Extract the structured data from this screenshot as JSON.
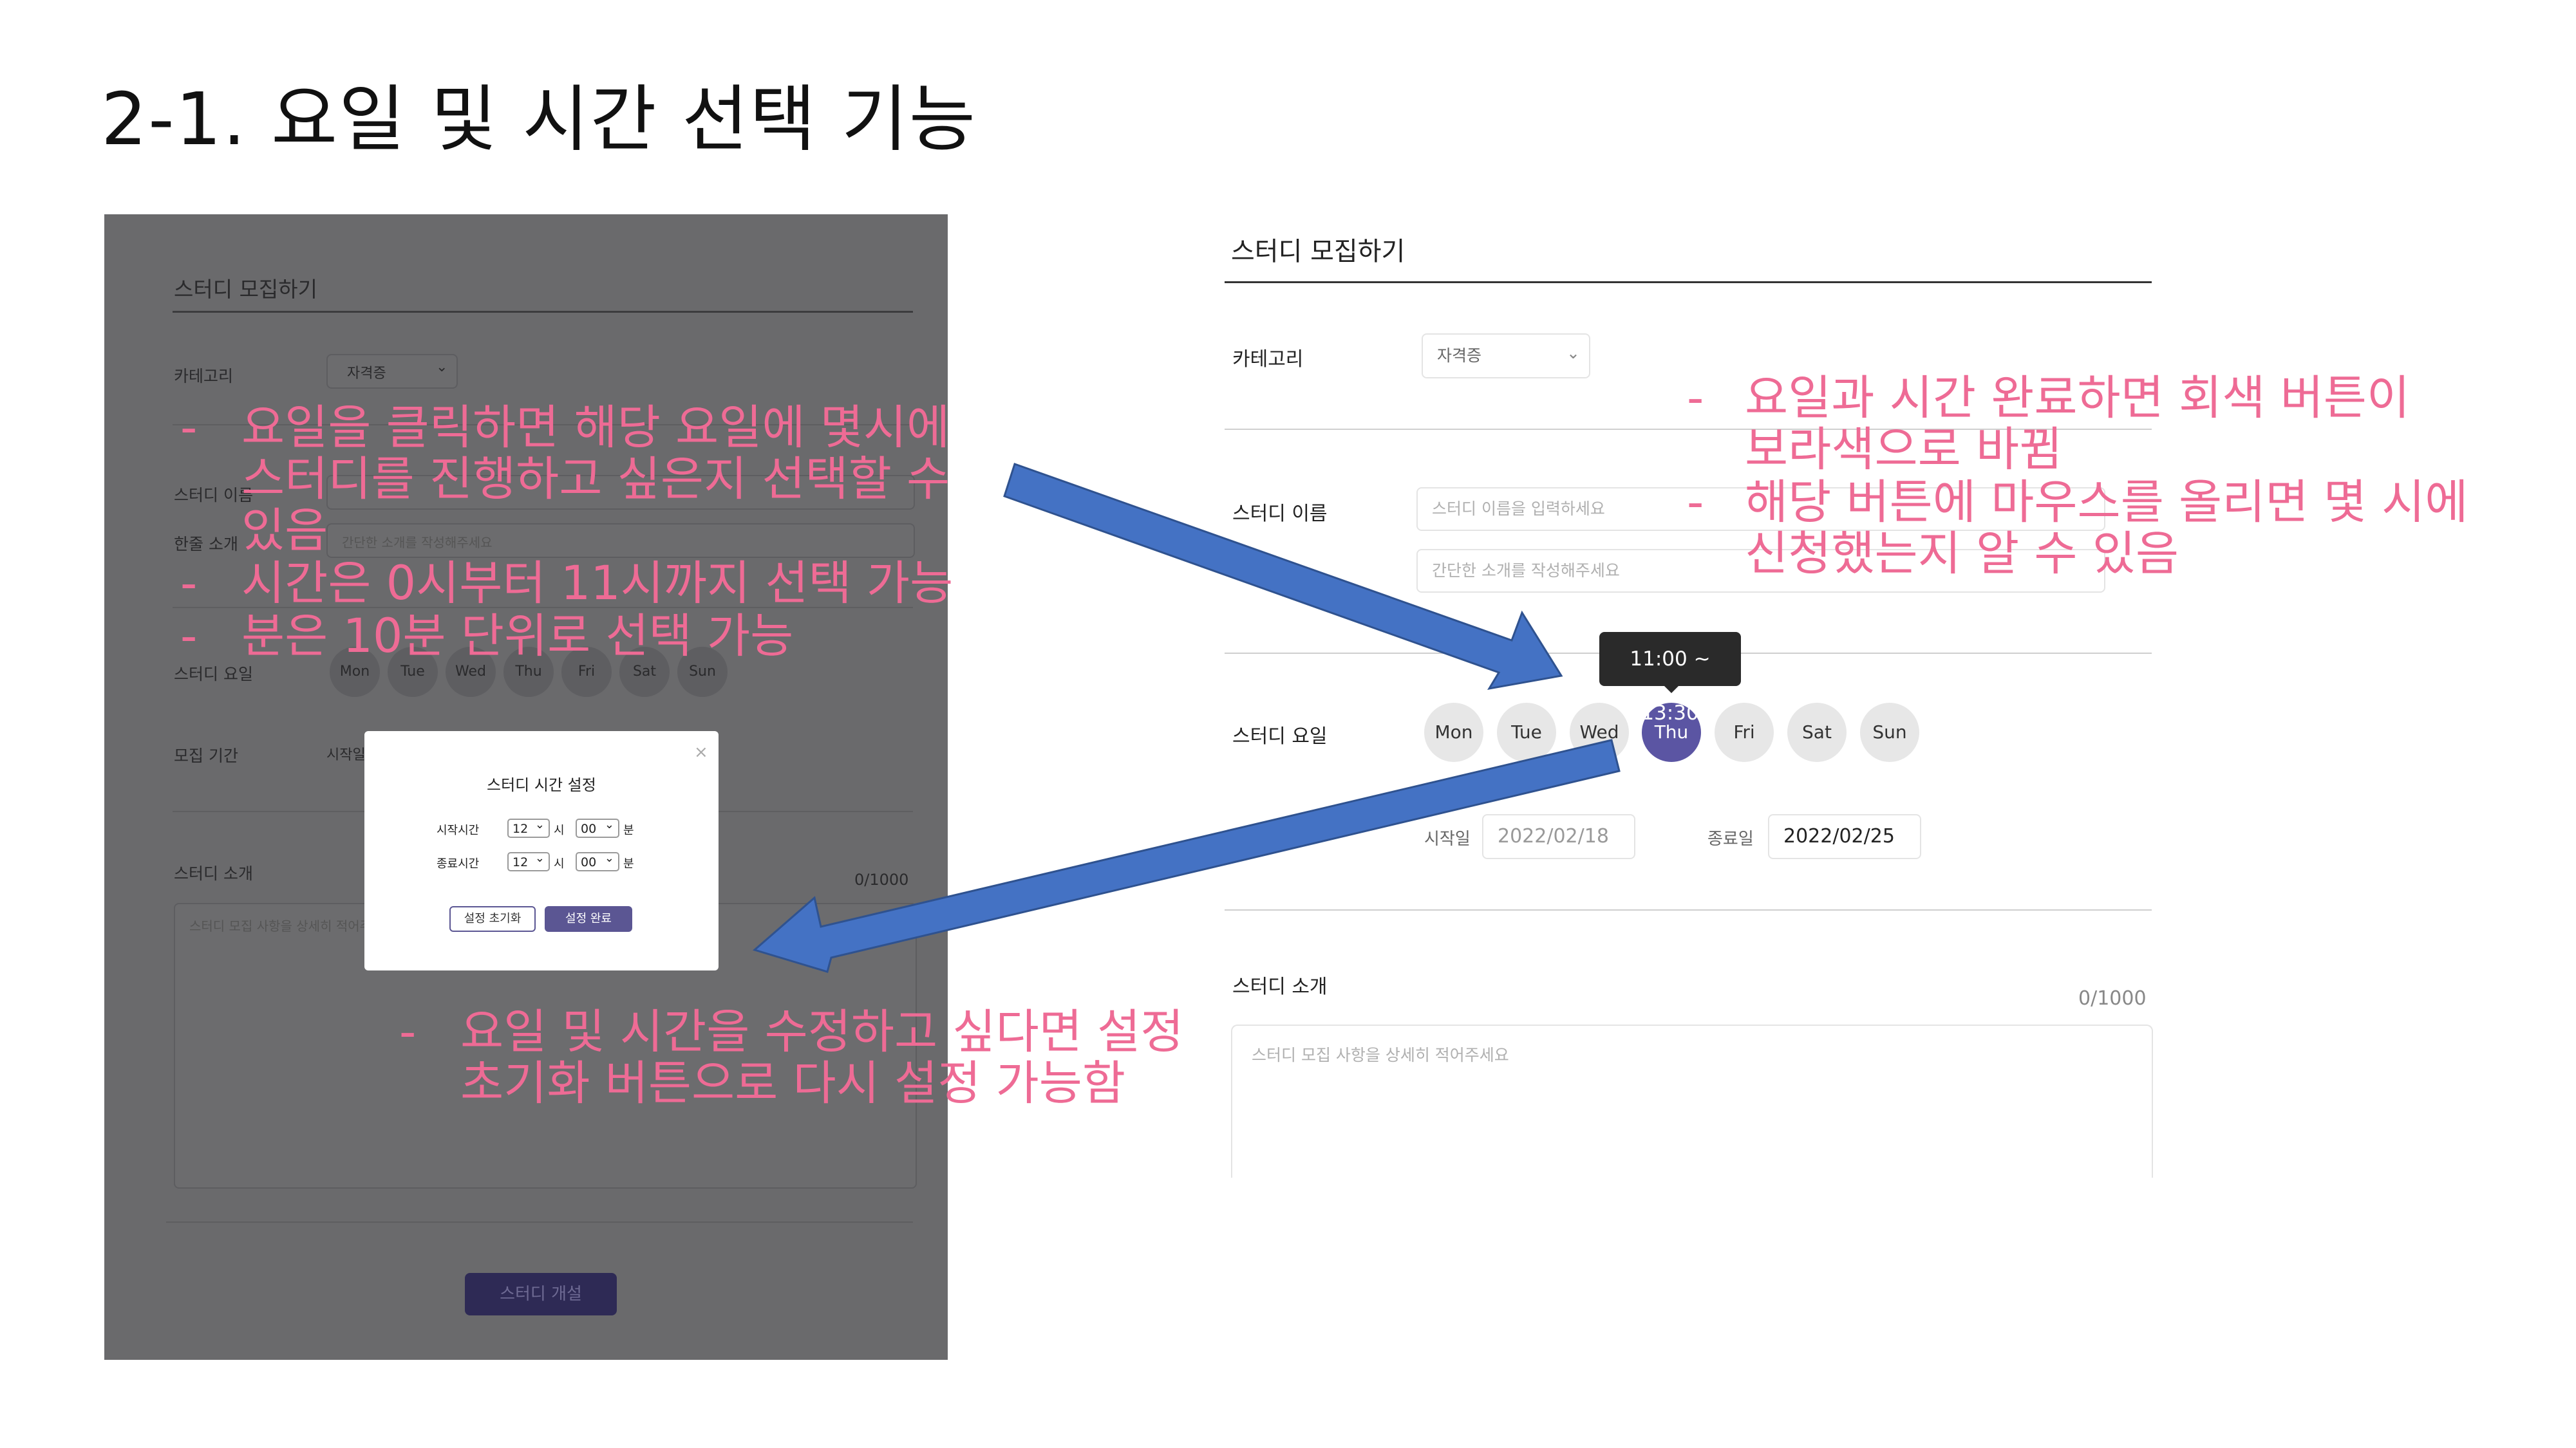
{
  "slide_title": "2-1. 요일 및 시간 선택 기능",
  "left_screenshot": {
    "header": "스터디 모집하기",
    "category_label": "카테고리",
    "category_value": "자격증",
    "name_label": "스터디 이름",
    "intro_label": "한줄 소개",
    "intro_placeholder": "간단한 소개를 작성해주세요",
    "day_label": "스터디 요일",
    "days": [
      "Mon",
      "Tue",
      "Wed",
      "Thu",
      "Fri",
      "Sat",
      "Sun"
    ],
    "period_label": "모집 기간",
    "period_start_label": "시작일",
    "desc_label": "스터디 소개",
    "desc_counter": "0/1000",
    "desc_placeholder": "스터디 모집 사항을 상세히 적어주세요",
    "open_button": "스터디 개설",
    "modal": {
      "title": "스터디 시간 설정",
      "close": "×",
      "start_label": "시작시간",
      "end_label": "종료시간",
      "hour_value": "12",
      "hour_unit": "시",
      "minute_value": "00",
      "minute_unit": "분",
      "reset_button": "설정 초기화",
      "done_button": "설정 완료"
    }
  },
  "right_screenshot": {
    "header": "스터디 모집하기",
    "category_label": "카테고리",
    "category_value": "자격증",
    "name_label": "스터디 이름",
    "name_placeholder": "스터디 이름을 입력하세요",
    "intro_placeholder": "간단한 소개를 작성해주세요",
    "day_label": "스터디 요일",
    "days": [
      "Mon",
      "Tue",
      "Wed",
      "Thu",
      "Fri",
      "Sat",
      "Sun"
    ],
    "selected_day": "Thu",
    "tooltip": "11:00 ~ 13:30",
    "start_label": "시작일",
    "start_date": "2022/02/18",
    "end_label": "종료일",
    "end_date": "2022/02/25",
    "desc_label": "스터디 소개",
    "desc_counter": "0/1000",
    "desc_placeholder": "스터디 모집 사항을 상세히 적어주세요"
  },
  "annotations": {
    "left_top": [
      "요일을 클릭하면 해당 요일에 몇시에",
      "스터디를 진행하고 싶은지 선택할 수",
      "있음",
      "시간은 0시부터 11시까지 선택 가능",
      "분은 10분 단위로 선택 가능"
    ],
    "right_top": [
      "요일과 시간 완료하면 회색 버튼이",
      "보라색으로 바뀜",
      "해당 버튼에 마우스를 올리면 몇 시에",
      "신청했는지 알 수 있음"
    ],
    "bottom": [
      "요일 및 시간을 수정하고 싶다면 설정",
      "초기화 버튼으로 다시 설정 가능함"
    ],
    "dash": "-"
  },
  "colors": {
    "annotation": "#ee6b95",
    "arrow": "#4472c4",
    "selected_day": "#5b55a3",
    "dim_overlay": "#6a6a6c"
  }
}
